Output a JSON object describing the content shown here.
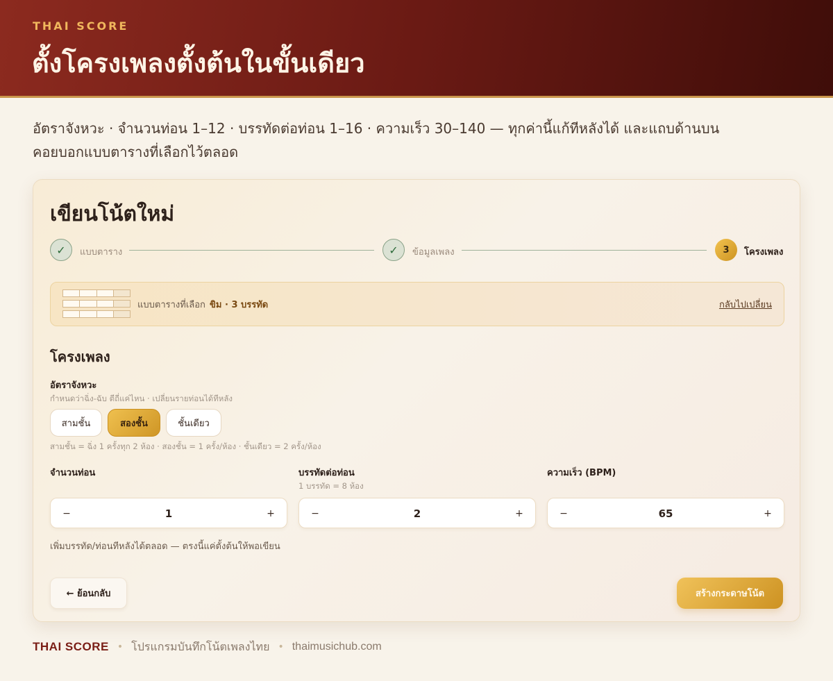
{
  "header": {
    "kicker": "THAI SCORE",
    "title": "ตั้งโครงเพลงตั้งต้นในขั้นเดียว"
  },
  "lede": "อัตราจังหวะ · จำนวนท่อน 1–12 · บรรทัดต่อท่อน 1–16 · ความเร็ว 30–140 — ทุกค่านี้แก้ทีหลังได้ และแถบด้านบนคอยบอกแบบตารางที่เลือกไว้ตลอด",
  "card": {
    "title": "เขียนโน้ตใหม่",
    "steps": [
      {
        "label": "แบบตาราง",
        "state": "done",
        "mark": "✓"
      },
      {
        "label": "ข้อมูลเพลง",
        "state": "done",
        "mark": "✓"
      },
      {
        "label": "โครงเพลง",
        "state": "active",
        "mark": "3"
      }
    ],
    "banner": {
      "label": "แบบตารางที่เลือก",
      "value": "ขิม · 3 บรรทัด",
      "change_link": "กลับไปเปลี่ยน"
    },
    "section_title": "โครงเพลง",
    "tempo": {
      "label": "อัตราจังหวะ",
      "hint": "กำหนดว่าฉิ่ง-ฉับ ตีถี่แค่ไหน · เปลี่ยนรายท่อนได้ทีหลัง",
      "options": [
        "สามชั้น",
        "สองชั้น",
        "ชั้นเดียว"
      ],
      "selected": "สองชั้น",
      "footnote": "สามชั้น = ฉิ่ง 1 ครั้งทุก 2 ห้อง · สองชั้น = 1 ครั้ง/ห้อง · ชั้นเดียว = 2 ครั้ง/ห้อง"
    },
    "sections_count": {
      "label": "จำนวนท่อน",
      "value": "1"
    },
    "lines_per_section": {
      "label": "บรรทัดต่อท่อน",
      "hint": "1 บรรทัด = 8 ห้อง",
      "value": "2"
    },
    "bpm": {
      "label": "ความเร็ว (BPM)",
      "value": "65"
    },
    "stepper_minus": "−",
    "stepper_plus": "+",
    "note": "เพิ่มบรรทัด/ท่อนทีหลังได้ตลอด — ตรงนี้แค่ตั้งต้นให้พอเขียน",
    "back_button": "← ย้อนกลับ",
    "create_button": "สร้างกระดาษโน้ต"
  },
  "footer": {
    "brand": "THAI SCORE",
    "tagline": "โปรแกรมบันทึกโน้ตเพลงไทย",
    "site": "thaimusichub.com"
  },
  "colors": {
    "header_bg": "#6a1a14",
    "accent_gold": "#e0aa3e",
    "brand_red": "#7a1e16",
    "page_bg": "#f8f3ea"
  }
}
